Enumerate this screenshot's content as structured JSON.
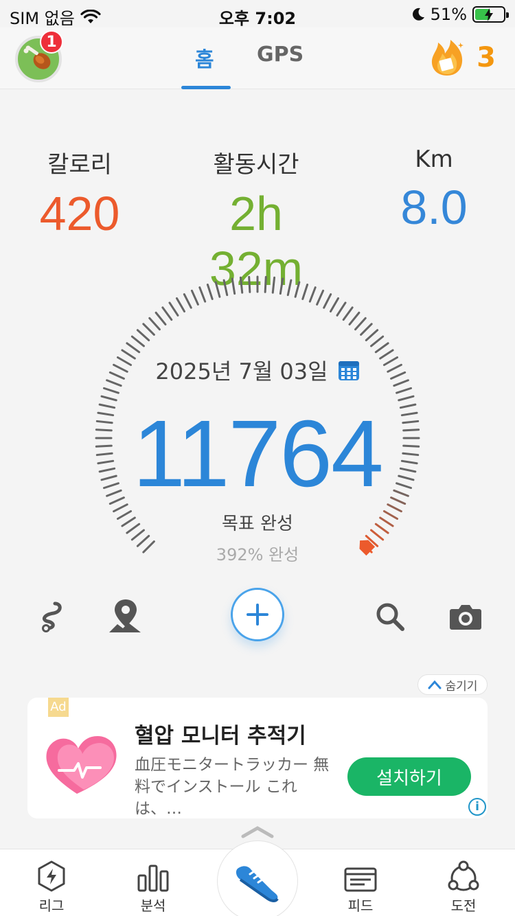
{
  "status_bar": {
    "carrier": "SIM 없음",
    "time": "오후 7:02",
    "battery": "51%"
  },
  "header": {
    "notification_count": "1",
    "tabs": [
      {
        "label": "홈"
      },
      {
        "label": "GPS"
      }
    ],
    "streak_count": "3"
  },
  "stats": {
    "calories": {
      "label": "칼로리",
      "value": "420"
    },
    "active_time": {
      "label": "활동시간",
      "value": "2h 32m"
    },
    "distance": {
      "label": "Km",
      "value": "8.0"
    }
  },
  "gauge": {
    "date": "2025년 7월 03일",
    "steps": "11764",
    "goal_text": "목표 완성",
    "percent_text": "392% 완성",
    "progress_fraction": 1.0
  },
  "colors": {
    "accent": "#2c86d8",
    "calories": "#ec5a2c",
    "time": "#74b032",
    "distance": "#3587d8",
    "install": "#1ab566"
  },
  "ad": {
    "hide_label": "숨기기",
    "tag": "Ad",
    "title": "혈압 모니터 추적기",
    "description": "血圧モニタートラッカー 無料でインストール これは、…",
    "install_label": "설치하기",
    "info": "i"
  },
  "bottom_nav": {
    "items": [
      {
        "label": "리그"
      },
      {
        "label": "분석"
      },
      {
        "label": "피드"
      },
      {
        "label": "도전"
      }
    ]
  }
}
